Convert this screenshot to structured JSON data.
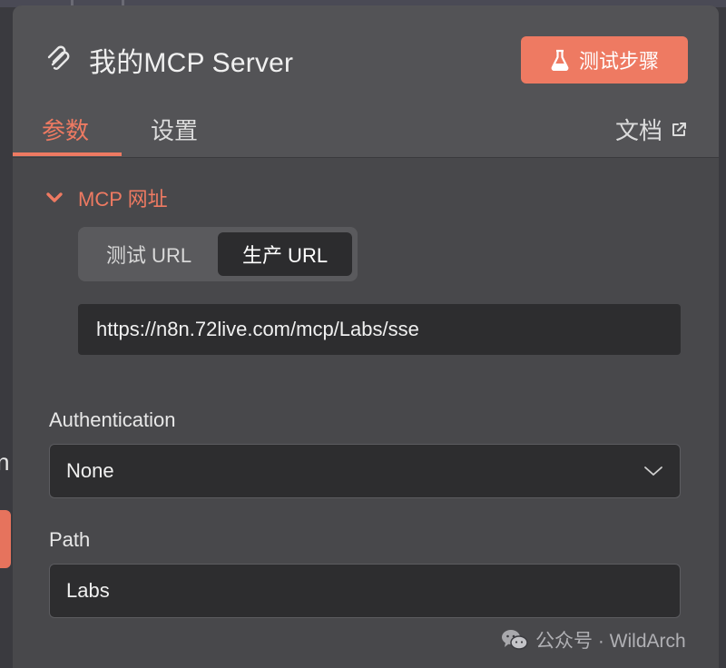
{
  "panel": {
    "title": "我的MCP Server",
    "test_button_label": "测试步骤",
    "tabs": [
      {
        "label": "参数",
        "active": true
      },
      {
        "label": "设置",
        "active": false
      }
    ],
    "docs_label": "文档"
  },
  "mcp_section": {
    "heading": "MCP 网址",
    "segments": [
      {
        "label": "测试 URL",
        "active": false
      },
      {
        "label": "生产 URL",
        "active": true
      }
    ],
    "url": "https://n8n.72live.com/mcp/Labs/sse"
  },
  "authentication": {
    "label": "Authentication",
    "value": "None"
  },
  "path": {
    "label": "Path",
    "value": "Labs"
  },
  "background": {
    "left_text": "n"
  },
  "watermark": {
    "text": "公众号 · WildArch"
  },
  "colors": {
    "accent": "#ee7a62",
    "panel": "#48484b",
    "header": "#535356",
    "field": "#2d2d2f"
  }
}
